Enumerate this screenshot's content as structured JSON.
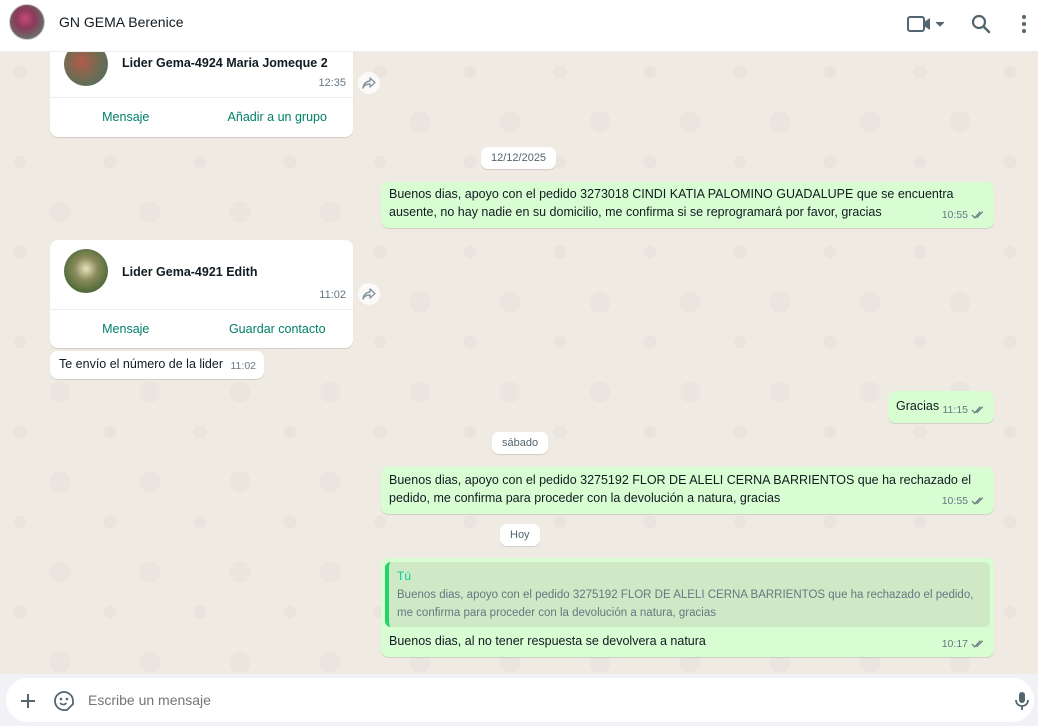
{
  "header": {
    "contact_name": "GN GEMA Berenice"
  },
  "cards": [
    {
      "name": "Lider Gema-4924 Maria Jomeque 2",
      "time": "12:35",
      "action_left": "Mensaje",
      "action_right": "Añadir a un grupo"
    },
    {
      "name": "Lider Gema-4921 Edith",
      "time": "11:02",
      "action_left": "Mensaje",
      "action_right": "Guardar contacto"
    }
  ],
  "dates": {
    "d1": "12/12/2025",
    "d2": "sábado",
    "d3": "Hoy"
  },
  "messages": {
    "m1": {
      "line1": "Buenos dias, apoyo con el pedido 3273018 CINDI KATIA PALOMINO GUADALUPE que se encuentra",
      "line2": "ausente, no hay nadie en su domicilio, me confirma si se reprogramará por favor, gracias",
      "time": "10:55"
    },
    "m2": {
      "text": "Te envío el número de la lider",
      "time": "11:02"
    },
    "m3": {
      "text": "Gracias",
      "time": "11:15"
    },
    "m4": {
      "line1": "Buenos dias, apoyo con el pedido 3275192 FLOR DE ALELI CERNA BARRIENTOS que ha rechazado el",
      "line2": "pedido, me confirma para proceder con la devolución a natura, gracias",
      "time": "10:55"
    },
    "m5": {
      "quote_author": "Tú",
      "quote_line1": "Buenos dias, apoyo con el pedido 3275192 FLOR DE ALELI CERNA BARRIENTOS que ha rechazado el pedido,",
      "quote_line2": "me confirma para proceder con la devolución a natura, gracias",
      "text": "Buenos dias, al no tener respuesta se devolvera a natura",
      "time": "10:17"
    }
  },
  "composer": {
    "placeholder": "Escribe un mensaje"
  },
  "colors": {
    "accent": "#008069",
    "outgoing_bubble": "#d9fdd3",
    "read_ticks": "#53bdeb"
  },
  "icons": [
    "video-call-icon",
    "search-icon",
    "menu-icon",
    "forward-icon",
    "plus-icon",
    "sticker-icon",
    "mic-icon",
    "double-check-icon"
  ]
}
